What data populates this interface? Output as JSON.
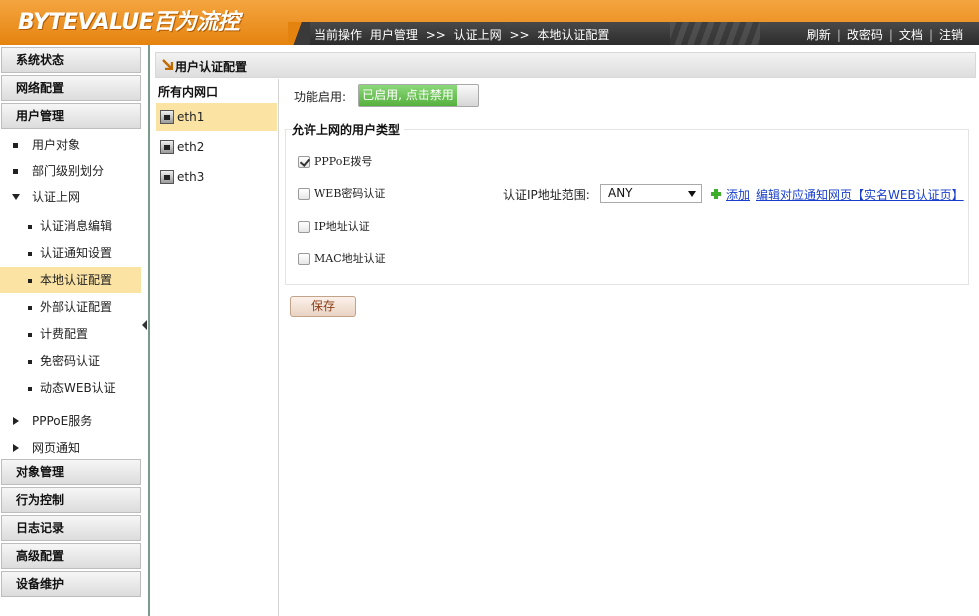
{
  "app": {
    "logo": "BYTEVALUE百为流控"
  },
  "breadcrumb": [
    "当前操作",
    "用户管理",
    ">>",
    "认证上网",
    ">>",
    "本地认证配置"
  ],
  "top_links": [
    "刷新",
    "改密码",
    "文档",
    "注销"
  ],
  "sidebar": {
    "heads_top": [
      "系统状态",
      "网络配置",
      "用户管理"
    ],
    "user_mgmt_items": [
      "用户对象",
      "部门级别划分"
    ],
    "auth_group": "认证上网",
    "auth_items": [
      "认证消息编辑",
      "认证通知设置",
      "本地认证配置",
      "外部认证配置",
      "计费配置",
      "免密码认证",
      "动态WEB认证"
    ],
    "auth_active_index": 2,
    "after_items": [
      "PPPoE服务",
      "网页通知"
    ],
    "heads_bottom": [
      "对象管理",
      "行为控制",
      "日志记录",
      "高级配置",
      "设备维护"
    ]
  },
  "panel": {
    "title": "用户认证配置",
    "iface_header": "所有内网口",
    "interfaces": [
      "eth1",
      "eth2",
      "eth3"
    ],
    "active_interface": "eth1",
    "func_label": "功能启用:",
    "toggle_label": "已启用, 点击禁用",
    "toggle_on": true,
    "group_title": "允许上网的用户类型",
    "auth_types": [
      {
        "label": "PPPoE拨号",
        "checked": true
      },
      {
        "label": "WEB密码认证",
        "checked": false
      },
      {
        "label": "IP地址认证",
        "checked": false
      },
      {
        "label": "MAC地址认证",
        "checked": false
      }
    ],
    "ip_range_label": "认证IP地址范围:",
    "ip_range_value": "ANY",
    "add_link": "添加",
    "edit_link": "编辑对应通知网页【实名WEB认证页】",
    "save_label": "保存"
  },
  "colors": {
    "header_orange": "#e5830f",
    "active_row": "#fbe3a4",
    "toggle_green": "#55b03d",
    "link_blue": "#1a3fcc"
  }
}
